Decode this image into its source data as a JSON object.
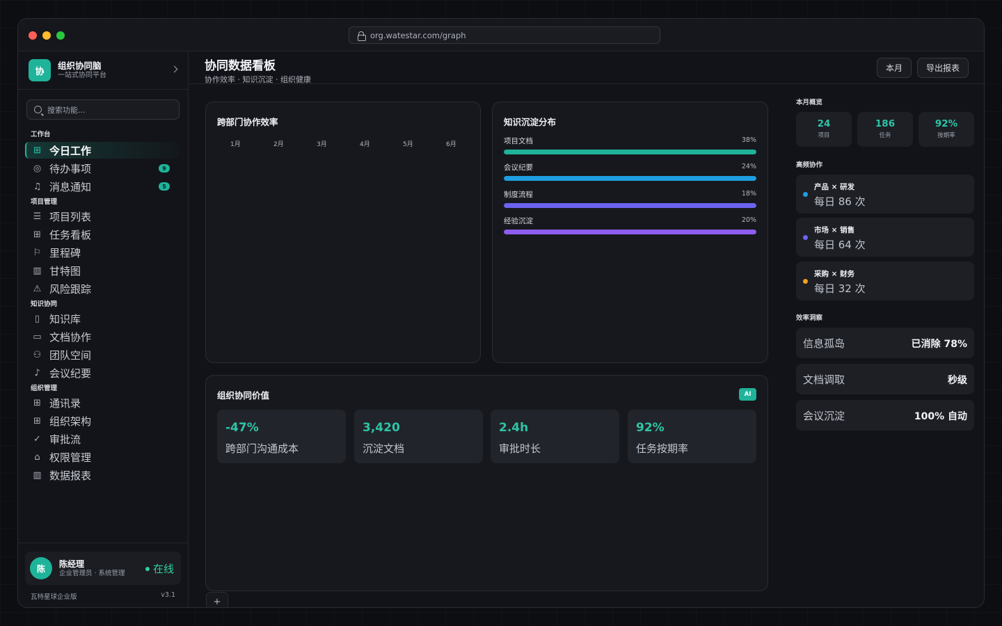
{
  "browser": {
    "url": "org.watestar.com/graph"
  },
  "brand": {
    "name": "组织协同脑",
    "subtitle": "一站式协同平台",
    "logo": "协"
  },
  "search": {
    "placeholder": "搜索功能..."
  },
  "sections": {
    "workbench": "工作台",
    "project": "项目管理",
    "knowledge": "知识协同",
    "org": "组织管理"
  },
  "nav": {
    "today": "今日工作",
    "todo": "待办事项",
    "todo_badge": "9",
    "notify": "消息通知",
    "notify_badge": "5",
    "projects": "项目列表",
    "kanban": "任务看板",
    "milestone": "里程碑",
    "gantt": "甘特图",
    "risk": "风险跟踪",
    "kb": "知识库",
    "docs": "文档协作",
    "team": "团队空间",
    "meeting": "会议纪要",
    "contacts": "通讯录",
    "orgchart": "组织架构",
    "approval": "审批流",
    "permission": "权限管理",
    "reports": "数据报表"
  },
  "user": {
    "avatar": "陈",
    "name": "陈经理",
    "role": "企业管理员 · 系统管理",
    "status": "在线"
  },
  "footer": {
    "edition": "瓦特星球企业版",
    "version": "v3.1"
  },
  "header": {
    "title": "协同数据看板",
    "subtitle": "协作效率 · 知识沉淀 · 组织健康",
    "btn_month": "本月",
    "btn_export": "导出报表"
  },
  "efficiency": {
    "title": "跨部门协作效率",
    "months": [
      "1月",
      "2月",
      "3月",
      "4月",
      "5月",
      "6月"
    ]
  },
  "knowledge": {
    "title": "知识沉淀分布",
    "items": [
      {
        "label": "项目文档",
        "pct": "38%",
        "color": "#1fb39a"
      },
      {
        "label": "会议纪要",
        "pct": "24%",
        "color": "#1e9ee0"
      },
      {
        "label": "制度流程",
        "pct": "18%",
        "color": "#6c63f0"
      },
      {
        "label": "经验沉淀",
        "pct": "20%",
        "color": "#8e5cf0"
      }
    ]
  },
  "value": {
    "title": "组织协同价值",
    "ai_badge": "AI",
    "metrics": [
      {
        "value": "-47%",
        "label": "跨部门沟通成本"
      },
      {
        "value": "3,420",
        "label": "沉淀文档"
      },
      {
        "value": "2.4h",
        "label": "审批时长"
      },
      {
        "value": "92%",
        "label": "任务按期率"
      }
    ]
  },
  "overview": {
    "title": "本月概览",
    "stats": [
      {
        "value": "24",
        "label": "项目"
      },
      {
        "value": "186",
        "label": "任务"
      },
      {
        "value": "92%",
        "label": "按期率"
      }
    ]
  },
  "collab": {
    "title": "高频协作",
    "items": [
      {
        "pair": "产品 × 研发",
        "freq": "每日 86 次",
        "color": "#1e9ee0"
      },
      {
        "pair": "市场 × 销售",
        "freq": "每日 64 次",
        "color": "#6c63f0"
      },
      {
        "pair": "采购 × 财务",
        "freq": "每日 32 次",
        "color": "#f0a020"
      }
    ]
  },
  "insights": {
    "title": "效率洞察",
    "items": [
      {
        "key": "信息孤岛",
        "value": "已消除 78%"
      },
      {
        "key": "文档调取",
        "value": "秒级"
      },
      {
        "key": "会议沉淀",
        "value": "100% 自动"
      }
    ]
  }
}
